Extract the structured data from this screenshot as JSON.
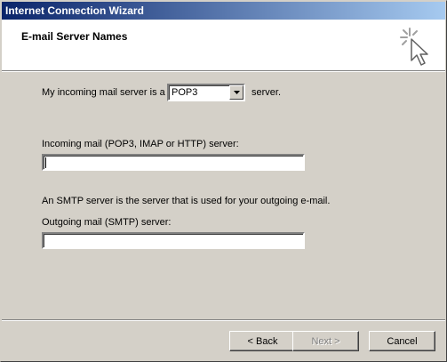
{
  "window": {
    "title": "Internet Connection Wizard"
  },
  "header": {
    "title": "E-mail Server Names"
  },
  "incoming_type": {
    "label_before": "My incoming mail server is a",
    "selected": "POP3",
    "label_after": "server."
  },
  "incoming_server": {
    "label": "Incoming mail (POP3, IMAP or HTTP) server:",
    "value": ""
  },
  "smtp_note": "An SMTP server is the server that is used for your outgoing e-mail.",
  "outgoing_server": {
    "label": "Outgoing mail (SMTP) server:",
    "value": ""
  },
  "buttons": {
    "back": "< Back",
    "next": "Next >",
    "cancel": "Cancel"
  },
  "colors": {
    "titlebar_start": "#0a246a",
    "titlebar_end": "#a6caf0",
    "face": "#d4d0c8"
  }
}
